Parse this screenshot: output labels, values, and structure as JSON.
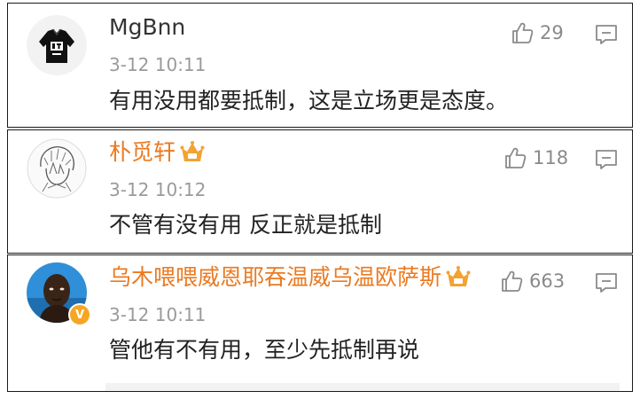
{
  "comments": [
    {
      "username": "MgBnn",
      "time": "3-12 10:11",
      "text": "有用没用都要抵制，这是立场更是态度。",
      "likes": "29",
      "vip": false,
      "verified": false,
      "avatar": "avatar-black-sweatshirt"
    },
    {
      "username": "朴觅轩",
      "time": "3-12 10:12",
      "text": "不管有没有用 反正就是抵制",
      "likes": "118",
      "vip": true,
      "verified": false,
      "avatar": "avatar-anime-sketch"
    },
    {
      "username": "乌木喂喂威恩耶吞温威乌温欧萨斯",
      "time": "3-12 10:11",
      "text": "管他有不有用，至少先抵制再说",
      "likes": "663",
      "vip": true,
      "verified": true,
      "avatar": "avatar-man-photo"
    }
  ],
  "icons": {
    "like": "thumbs-up-icon",
    "reply": "comment-icon",
    "vip": "vip-crown-icon",
    "verified": "verified-v-icon"
  },
  "colors": {
    "vip_name": "#ea7a22",
    "normal_name": "#333333",
    "timestamp": "#9a9a9a",
    "icon_gray": "#8a8a8a",
    "verified_badge": "#f5a623"
  }
}
